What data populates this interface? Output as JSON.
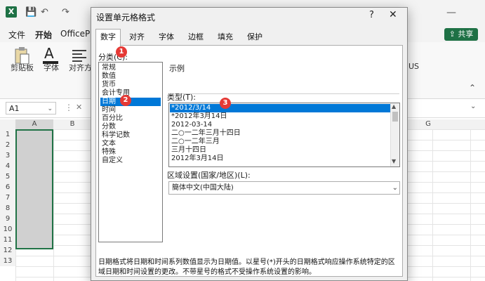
{
  "excel": {
    "quick_access": [
      "💾",
      "↶",
      "↷"
    ],
    "menu_tabs": [
      "文件",
      "开始",
      "OfficePLU"
    ],
    "share_label": "共享",
    "ribbon": {
      "clipboard": "剪贴板",
      "font": "字体",
      "alignment": "对齐方式",
      "us": "US"
    },
    "namebox": "A1",
    "columns": [
      "A",
      "B",
      "G"
    ],
    "rows": [
      "1",
      "2",
      "3",
      "4",
      "5",
      "6",
      "7",
      "8",
      "9",
      "10",
      "11",
      "12",
      "13"
    ]
  },
  "dialog": {
    "title": "设置单元格格式",
    "help": "?",
    "close": "✕",
    "tabs": [
      "数字",
      "对齐",
      "字体",
      "边框",
      "填充",
      "保护"
    ],
    "category_label": "分类(C):",
    "categories": [
      "常规",
      "数值",
      "货币",
      "会计专用",
      "日期",
      "时间",
      "百分比",
      "分数",
      "科学记数",
      "文本",
      "特殊",
      "自定义"
    ],
    "selected_category_index": 4,
    "sample_label": "示例",
    "type_label": "类型(T):",
    "types": [
      "*2012/3/14",
      "*2012年3月14日",
      "2012-03-14",
      "二○一二年三月十四日",
      "二○一二年三月",
      "三月十四日",
      "2012年3月14日"
    ],
    "selected_type_index": 0,
    "locale_label": "区域设置(国家/地区)(L):",
    "locale_value": "簡体中文(中国大陆)",
    "description": "日期格式将日期和时间系列数值显示为日期值。以星号(*)开头的日期格式响应操作系统特定的区域日期和时间设置的更改。不带星号的格式不受操作系统设置的影响。"
  },
  "badges": [
    "1",
    "2",
    "3"
  ],
  "colors": {
    "accent": "#0078d7",
    "excel_green": "#1e7145",
    "badge": "#e53935"
  }
}
